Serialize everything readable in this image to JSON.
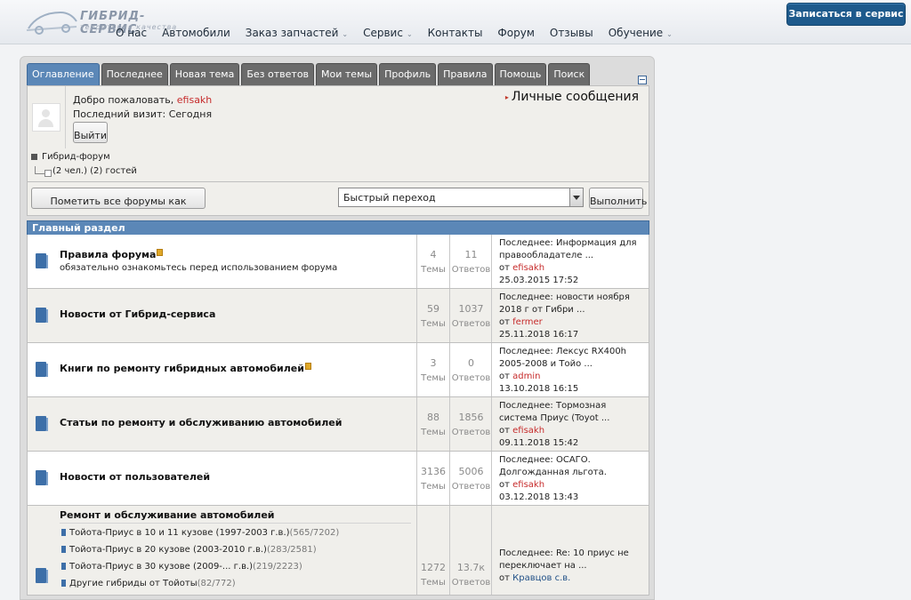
{
  "site": {
    "logo_title": "ГИБРИД-СЕРВИС",
    "logo_subtitle": "территория качества",
    "cta_label": "Записаться в сервис",
    "nav": [
      {
        "label": "О нас",
        "has_dropdown": false
      },
      {
        "label": "Автомобили",
        "has_dropdown": false
      },
      {
        "label": "Заказ запчастей",
        "has_dropdown": true
      },
      {
        "label": "Сервис",
        "has_dropdown": true
      },
      {
        "label": "Контакты",
        "has_dropdown": false
      },
      {
        "label": "Форум",
        "has_dropdown": false
      },
      {
        "label": "Отзывы",
        "has_dropdown": false
      },
      {
        "label": "Обучение",
        "has_dropdown": true
      }
    ]
  },
  "forum": {
    "tabs": [
      "Оглавление",
      "Последнее",
      "Новая тема",
      "Без ответов",
      "Мои темы",
      "Профиль",
      "Правила",
      "Помощь",
      "Поиск"
    ],
    "active_tab": "Оглавление",
    "welcome_prefix": "Добро пожаловать,",
    "username": "efisakh",
    "last_visit_label": "Последний визит:",
    "last_visit_value": "Сегодня",
    "logout_label": "Выйти",
    "private_messages": "Личные сообщения",
    "breadcrumb": "Гибрид-форум",
    "online_text": "(2 чел.) (2) гостей",
    "mark_read_label": "Пометить все форумы как прочитанные",
    "quick_jump_placeholder": "Быстрый переход",
    "go_label": "Выполнить",
    "category_title": "Главный раздел",
    "topics_label": "Темы",
    "replies_label": "Ответов",
    "from_label": "от",
    "forums": [
      {
        "title": "Правила форума",
        "locked": true,
        "description": "обязательно ознакомьтесь перед использованием форума",
        "topics": "4",
        "replies": "11",
        "last_post": "Последнее: Информация для правообладателе ...",
        "last_by": "efisakh",
        "last_date": "25.03.2015 17:52"
      },
      {
        "title": "Новости от Гибрид-сервиса",
        "locked": false,
        "description": "",
        "topics": "59",
        "replies": "1037",
        "last_post": "Последнее: новости ноября 2018 г от Гибри ...",
        "last_by": "fermer",
        "last_date": "25.11.2018 16:17"
      },
      {
        "title": "Книги по ремонту гибридных автомобилей",
        "locked": true,
        "description": "",
        "topics": "3",
        "replies": "0",
        "last_post": "Последнее: Лексус RX400h 2005-2008 и Тойо ...",
        "last_by": "admin",
        "last_date": "13.10.2018 16:15"
      },
      {
        "title": "Статьи по ремонту и обслуживанию автомобилей",
        "locked": false,
        "description": "",
        "topics": "88",
        "replies": "1856",
        "last_post": "Последнее: Тормозная система Приус (Toyot ...",
        "last_by": "efisakh",
        "last_date": "09.11.2018 15:42"
      },
      {
        "title": "Новости от пользователей",
        "locked": false,
        "description": "",
        "topics": "3136",
        "replies": "5006",
        "last_post": "Последнее: ОСАГО. Долгожданная льгота.",
        "last_by": "efisakh",
        "last_date": "03.12.2018 13:43"
      },
      {
        "title": "Ремонт и обслуживание автомобилей",
        "locked": false,
        "description": "",
        "topics": "1272",
        "replies": "13.7к",
        "last_post": "Последнее: Re: 10 приус не переключает на ...",
        "last_by": "Кравцов с.в.",
        "last_date": "",
        "subforums": [
          {
            "label": "Тойота-Приус в 10 и 11 кузове (1997-2003 г.в.)",
            "count": "(565/7202)"
          },
          {
            "label": "Тойота-Приус в 20 кузове (2003-2010 г.в.)",
            "count": "(283/2581)"
          },
          {
            "label": "Тойота-Приус в 30 кузове (2009-... г.в.)",
            "count": "(219/2223)"
          },
          {
            "label": "Другие гибриды от Тойоты",
            "count": "(82/772)"
          }
        ]
      }
    ]
  },
  "colors": {
    "tab_active": "#5b87b7",
    "tab_inactive": "#6b6b6b",
    "cta_bg": "#1e5a8c",
    "username_red": "#c62b2b",
    "forum_icon": "#3d6fa8"
  }
}
